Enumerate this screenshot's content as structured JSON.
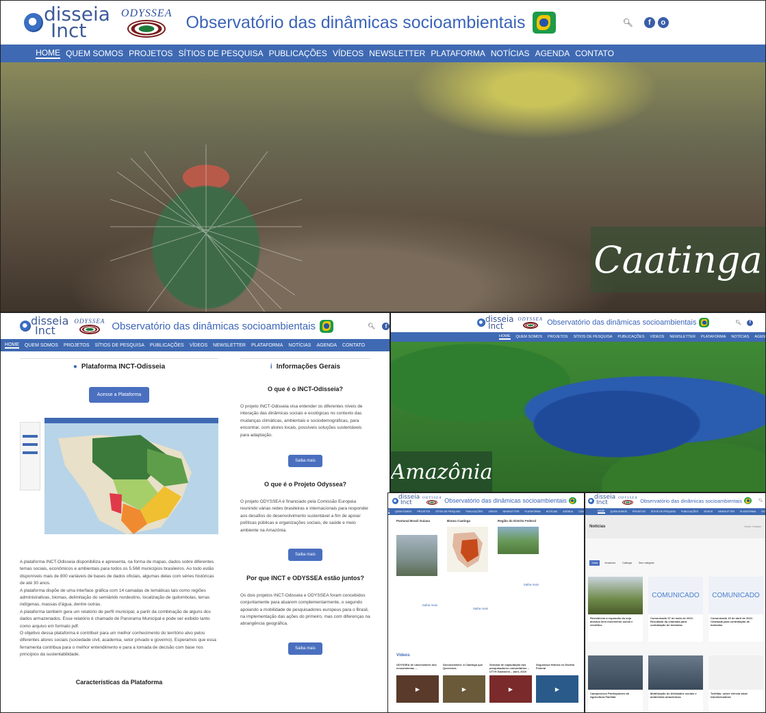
{
  "logo": {
    "odisseia_o": "O",
    "odisseia_rest": "disseia",
    "odisseia_inct": "Inct",
    "odyssea": "ODYSSEA"
  },
  "site_title": "Observatório das dinâmicas socioambientais",
  "header_icons": {
    "search": "search-icon",
    "facebook": "f",
    "other": "o"
  },
  "nav": [
    "HOME",
    "QUEM SOMOS",
    "PROJETOS",
    "SÍTIOS DE PESQUISA",
    "PUBLICAÇÕES",
    "VÍDEOS",
    "NEWSLETTER",
    "PLATAFORMA",
    "NOTÍCIAS",
    "AGENDA",
    "CONTATO"
  ],
  "hero_main": {
    "caption": "Caatinga"
  },
  "platform_page": {
    "section_title": "Plataforma INCT-Odisseia",
    "access_button": "Acesse a Plataforma",
    "description": [
      "A plataforma INCT-Odisseia disponibiliza e apresenta, na forma de mapas, dados sobre diferentes temas sociais, econômicos e ambientais para todos os 5.568 municípios brasileiros. Ao todo estão disponíveis mais de 800 variáveis de bases de dados oficiais, algumas delas com séries históricas de até 30 anos.",
      "A plataforma dispõe de uma interface gráfica com 14 camadas de temáticas tais como regiões administrativas, biomas, delimitação do semiárido nordestino, localização de quilombolas, terras indígenas, massas d'água, dentre outras.",
      "A plataforma também gera um relatório de perfil municipal, a partir da combinação de alguns dos dados armazenados. Esse relatório é chamado de Panorama Municipal e pode ser exibido tanto como arquivo em formato pdf.",
      "O objetivo dessa plataforma é contribuir para um melhor conhecimento do território alvo pelos diferentes atores sociais (sociedade civil, academia, setor privado e governo). Esperamos que essa ferramenta contribua para o melhor entendimento e para a tomada de decisão com base nos princípios da sustentabilidade."
    ],
    "features_title": "Características da Plataforma",
    "info_title": "Informações Gerais",
    "q1": "O que é o INCT-Odisseia?",
    "a1": "O projeto INCT-Odisseia visa entender os diferentes níveis de interação das dinâmicas sociais e ecológicas no contexto das mudanças climáticas, ambientais e sociodemográficas, para encontrar, com atores locais, possíveis soluções sustentáveis para adaptação.",
    "q2": "O que é o Projeto Odyssea?",
    "a2": "O projeto ODYSSEA é financiado pela Comissão Europeia reunindo várias redes brasileiras e internacionais para responder aos desafios do desenvolvimento sustentável a fim de apoiar políticas públicas e organizações sociais, de saúde e meio ambiente na Amazônia.",
    "q3": "Por que INCT e ODYSSEA estão juntos?",
    "a3": "Os dois projetos INCT-Odisseia e ODYSSEA foram concebidos conjuntamente para atuarem complementarmente, o segundo apoiando a mobilidade de pesquisadores europeus para o Brasil, na implementação das ações do primeiro, mas com diferenças na abrangência geográfica.",
    "more": "Saiba mais"
  },
  "amazon_hero": {
    "caption": "Amazônia"
  },
  "sites_page": {
    "cols": [
      "Pantanal Brasil Guiana",
      "Bioma Caatinga",
      "Região do Distrito Federal"
    ],
    "more": "Saiba mais",
    "videos_title": "Vídeos",
    "videos": [
      "ODYSSEA de observatório dos ecossistemas ...",
      "Documentário: A Caatinga que Queremos",
      "Semana de capacitação dos pesquisadores comunitários – UTTH Santarém – abril, 2019",
      "Segurança Hídrica no Distrito Federal"
    ]
  },
  "news_page": {
    "title": "Notícias",
    "breadcrumb": "Home / Notícias",
    "filters": [
      "Todas",
      "Amazônia",
      "Caatinga",
      "Sem categoria"
    ],
    "cards": [
      {
        "title": "Resistência à expansão da soja alcança mini movimento social e científico"
      },
      {
        "title": "Comunicado 07 de maio de 2021: Resultado da chamada para contratação de bolsistas"
      },
      {
        "title": "Comunicado 19 de abril de 2021: Chamada para contratação de bolsistas"
      },
      {
        "title": "Camponeses Participantes da Agricultura Familiar"
      },
      {
        "title": "Mobilização de Atividades sociais e ambientais amazônicas"
      },
      {
        "title": "Tortillas: sobre ciência atual transformadora"
      }
    ],
    "comunicado": "COMUNICADO"
  }
}
